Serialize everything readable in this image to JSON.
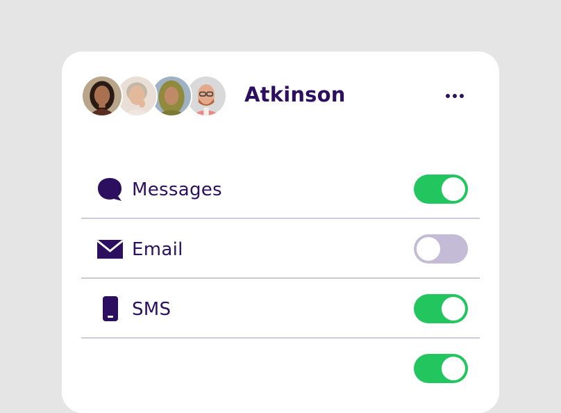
{
  "header": {
    "title": "Atkinson",
    "avatars": [
      {
        "name": "avatar-woman-dark-hair",
        "bg": "#b9a58a"
      },
      {
        "name": "avatar-woman-gray-hair",
        "bg": "#e9dfd6"
      },
      {
        "name": "avatar-woman-hijab",
        "bg": "#9fb2c4"
      },
      {
        "name": "avatar-man-glasses",
        "bg": "#d9d9d9"
      }
    ],
    "more_icon": "more-horizontal-icon"
  },
  "settings": [
    {
      "label": "Messages",
      "icon": "chat-bubble-icon",
      "enabled": true
    },
    {
      "label": "Email",
      "icon": "envelope-icon",
      "enabled": false
    },
    {
      "label": "SMS",
      "icon": "mobile-phone-icon",
      "enabled": true
    }
  ],
  "colors": {
    "accent_text": "#2c0f5e",
    "toggle_on": "#22c55e",
    "toggle_off": "#c4bcd7",
    "divider": "#cdc8da",
    "background": "#e5e5e5"
  }
}
